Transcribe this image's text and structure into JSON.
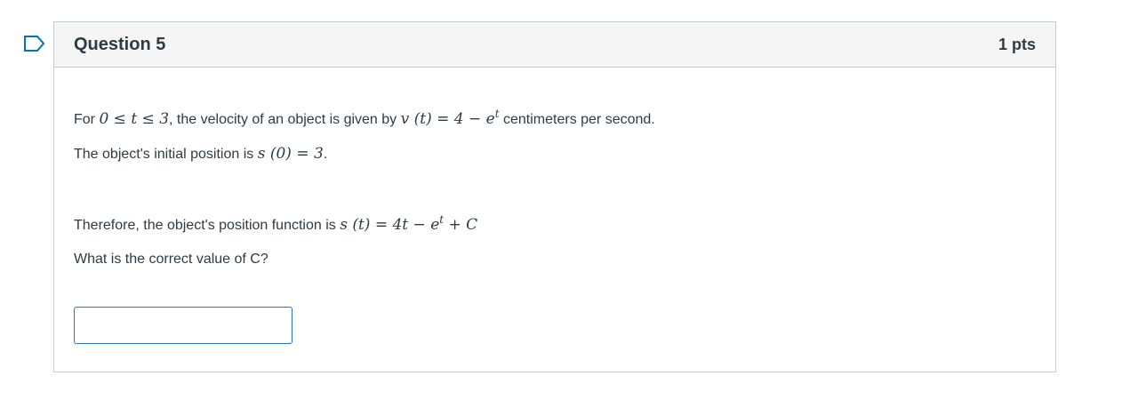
{
  "question": {
    "title": "Question 5",
    "points": "1 pts",
    "line1": {
      "prefix": "For ",
      "cond": "0 ≤ t ≤ 3",
      "mid": ", the velocity of an object is given by ",
      "func_lhs": "v (t) = 4 − e",
      "func_sup": "t",
      "suffix": " centimeters per second."
    },
    "line2": {
      "prefix": "The object's initial position is ",
      "math": "s (0) = 3",
      "suffix": "."
    },
    "line3": {
      "prefix": "Therefore, the object's position function is ",
      "math_a": "s (t) = 4t − e",
      "math_sup": "t",
      "math_b": " + C"
    },
    "line4": "What is the correct value of C?",
    "answer": {
      "value": "",
      "placeholder": ""
    }
  },
  "colors": {
    "header_bg": "#f5f5f5",
    "border": "#c7cdd1",
    "text": "#2d3b45",
    "input_border": "#2d75b3",
    "flag": "#0374b5"
  },
  "icons": {
    "flag": "flag-question-icon"
  }
}
